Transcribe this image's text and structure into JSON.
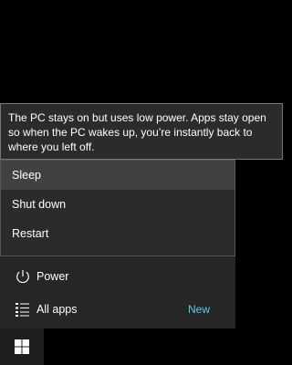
{
  "tooltip": {
    "text": "The PC stays on but uses low power. Apps stay open so when the PC wakes up, you’re instantly back to where you left off."
  },
  "power_menu": {
    "items": [
      {
        "label": "Sleep"
      },
      {
        "label": "Shut down"
      },
      {
        "label": "Restart"
      }
    ]
  },
  "start_menu": {
    "power_label": "Power",
    "all_apps_label": "All apps",
    "all_apps_badge": "New"
  },
  "icons": {
    "power": "power-icon",
    "all_apps": "list-icon",
    "start": "windows-logo-icon"
  },
  "colors": {
    "accent": "#5ecbf1",
    "menu_bg": "#2b2b2b",
    "selected_bg": "#414141",
    "panel_bg": "#262626"
  }
}
